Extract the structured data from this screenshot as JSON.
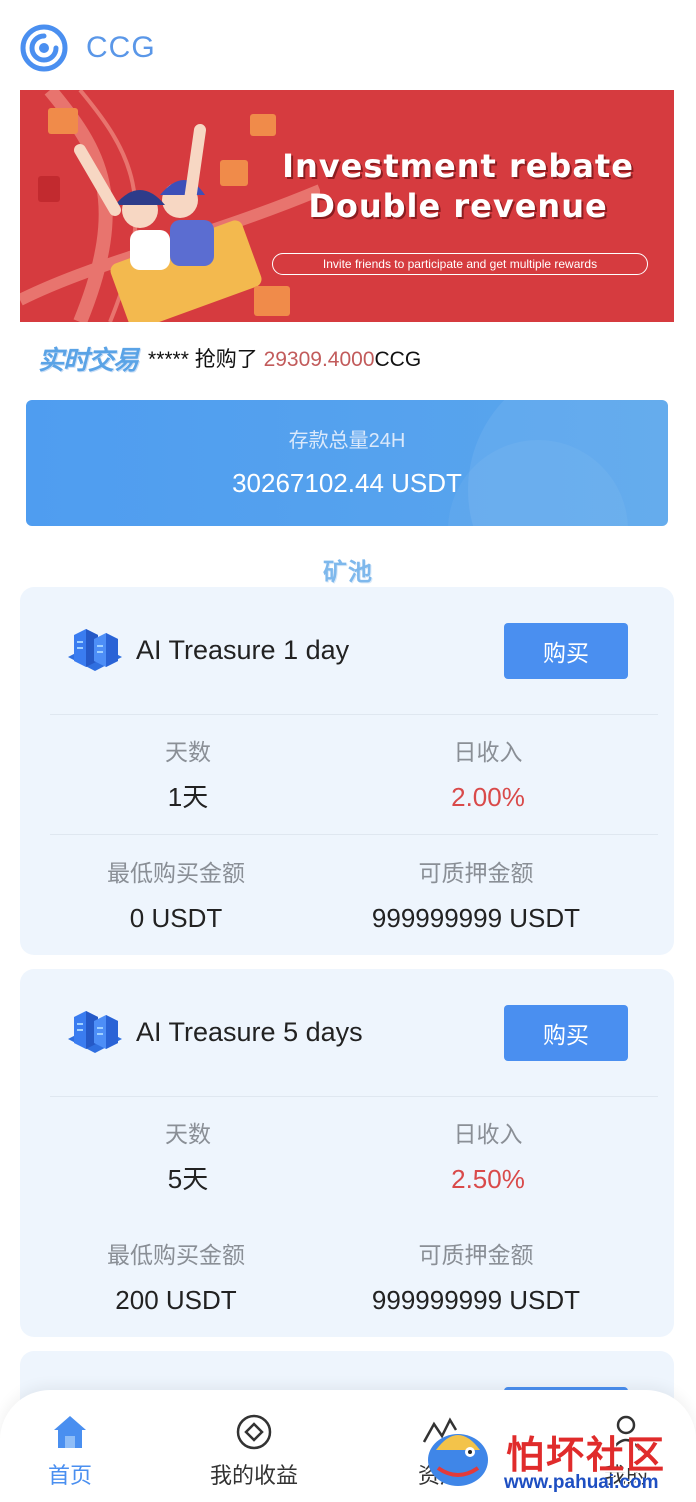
{
  "header": {
    "brand": "CCG"
  },
  "banner": {
    "title_line1": "Investment rebate",
    "title_line2": "Double revenue",
    "subtitle": "Invite friends to participate and get multiple rewards"
  },
  "ticker": {
    "label": "实时交易",
    "user": "*****",
    "action": " 抢购了 ",
    "amount": "29309.4000",
    "currency": "CCG"
  },
  "deposit": {
    "label": "存款总量24H",
    "value": "30267102.44 USDT"
  },
  "section_title": "矿池",
  "pools": [
    {
      "name": "AI Treasure 1 day",
      "buy_label": "购买",
      "days_label": "天数",
      "days_value": "1天",
      "daily_label": "日收入",
      "daily_value": "2.00%",
      "min_label": "最低购买金额",
      "min_value": "0 USDT",
      "pledge_label": "可质押金额",
      "pledge_value": "999999999 USDT"
    },
    {
      "name": "AI Treasure 5 days",
      "buy_label": "购买",
      "days_label": "天数",
      "days_value": "5天",
      "daily_label": "日收入",
      "daily_value": "2.50%",
      "min_label": "最低购买金额",
      "min_value": "200 USDT",
      "pledge_label": "可质押金额",
      "pledge_value": "999999999 USDT"
    }
  ],
  "tabbar": {
    "items": [
      {
        "label": "首页",
        "icon": "home-icon",
        "active": true
      },
      {
        "label": "我的收益",
        "icon": "earnings-icon",
        "active": false
      },
      {
        "label": "资产",
        "icon": "assets-icon",
        "active": false
      },
      {
        "label": "我的",
        "icon": "profile-icon",
        "active": false
      }
    ]
  },
  "watermark": {
    "title": "怕坏社区",
    "url": "www.pahuai.com"
  },
  "colors": {
    "accent": "#4a8ff0",
    "banner": "#d63b3f",
    "rate": "#d94a4a",
    "card": "#eef5fd"
  }
}
